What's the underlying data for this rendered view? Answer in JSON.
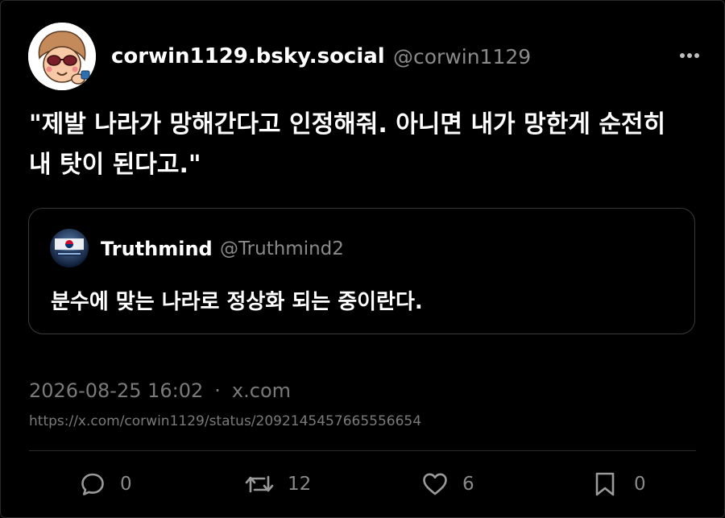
{
  "post": {
    "display_name": "corwin1129.bsky.social",
    "handle": "@corwin1129",
    "text": "\"제발 나라가 망해간다고 인정해줘. 아니면 내가 망한게 순전히 내 탓이 된다고.\"",
    "timestamp": "2026-08-25 16:02",
    "separator": "·",
    "source": "x.com",
    "url": "https://x.com/corwin1129/status/2092145457665556654"
  },
  "quote": {
    "display_name": "Truthmind",
    "handle": "@Truthmind2",
    "text": "분수에 맞는 나라로 정상화 되는 중이란다."
  },
  "actions": {
    "replies": "0",
    "reposts": "12",
    "likes": "6",
    "bookmarks": "0"
  },
  "icons": [
    "more-icon",
    "reply-icon",
    "repost-icon",
    "like-icon",
    "bookmark-icon"
  ],
  "colors": {
    "background": "#000000",
    "text": "#ffffff",
    "muted": "#8a8a8a",
    "border": "#3a3a3a"
  }
}
